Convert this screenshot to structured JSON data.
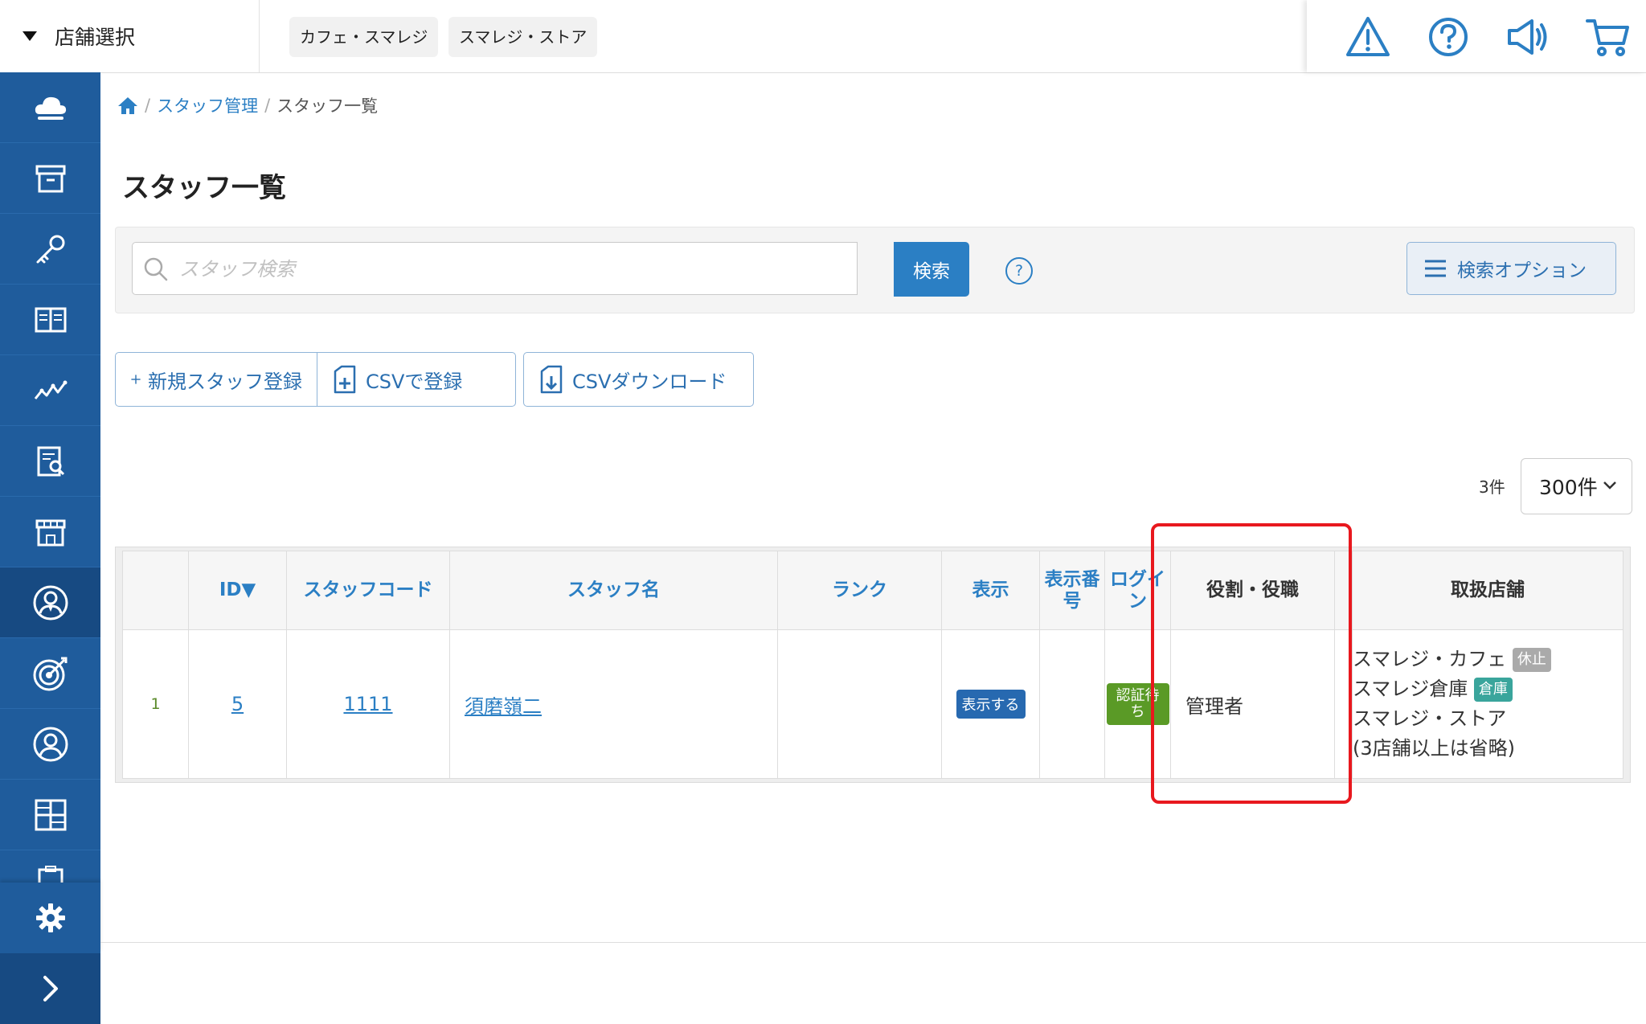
{
  "topbar": {
    "store_select_label": "店舗選択",
    "stores": [
      "カフェ・スマレジ",
      "スマレジ・ストア"
    ],
    "icons": [
      "warning-icon",
      "help-icon",
      "megaphone-icon",
      "cart-icon"
    ]
  },
  "sidebar": {
    "items": [
      "cloud-icon",
      "archive-icon",
      "key-icon",
      "book-icon",
      "chart-line-icon",
      "report-search-icon",
      "store-icon",
      "staff-icon",
      "target-icon",
      "user-icon",
      "layout-icon",
      "clipboard-icon"
    ],
    "active": "staff-icon",
    "bottom": [
      "gear-icon",
      "expand-icon"
    ]
  },
  "breadcrumb": {
    "items": [
      {
        "label": "スタッフ管理"
      },
      {
        "label": "スタッフ一覧"
      }
    ]
  },
  "page_title": "スタッフ一覧",
  "search": {
    "placeholder": "スタッフ検索",
    "button": "検索",
    "help": "?",
    "options_button": "検索オプション"
  },
  "actions": {
    "new_staff": "新規スタッフ登録",
    "csv_register": "CSVで登録",
    "csv_download": "CSVダウンロード"
  },
  "pagination": {
    "count": "3件",
    "per_page": "300件"
  },
  "table": {
    "headers": {
      "id": "ID▼",
      "code": "スタッフコード",
      "name": "スタッフ名",
      "rank": "ランク",
      "display": "表示",
      "display_no": "表示番号",
      "login": "ログイン",
      "role": "役割・役職",
      "stores": "取扱店舗"
    },
    "rows": [
      {
        "no": "1",
        "id": "5",
        "code": "1111",
        "name": "須磨嶺二",
        "rank": "",
        "display": "表示する",
        "display_no": "",
        "login": "認証待ち",
        "role": "管理者",
        "stores": [
          {
            "name": "スマレジ・カフェ",
            "tag": "休止"
          },
          {
            "name": "スマレジ倉庫",
            "tag": "倉庫"
          },
          {
            "name": "スマレジ・ストア",
            "tag": ""
          },
          {
            "name": "(3店舗以上は省略)",
            "tag": ""
          }
        ]
      }
    ]
  },
  "colors": {
    "sidebar": "#1f5c9c",
    "accent": "#2b7fc4",
    "highlight": "#e8181e"
  }
}
